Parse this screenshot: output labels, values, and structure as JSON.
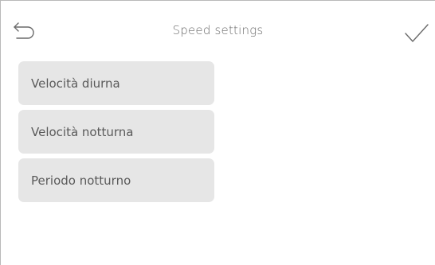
{
  "header": {
    "title": "Speed settings",
    "back_icon": "back-arrow-icon",
    "confirm_icon": "checkmark-icon"
  },
  "menu": {
    "items": [
      {
        "label": "Velocità diurna"
      },
      {
        "label": "Velocità notturna"
      },
      {
        "label": "Periodo notturno"
      }
    ]
  },
  "colors": {
    "background": "#ffffff",
    "item_background": "#e6e6e6",
    "text": "#5a5a5a",
    "icon_stroke": "#6a6a6a"
  }
}
